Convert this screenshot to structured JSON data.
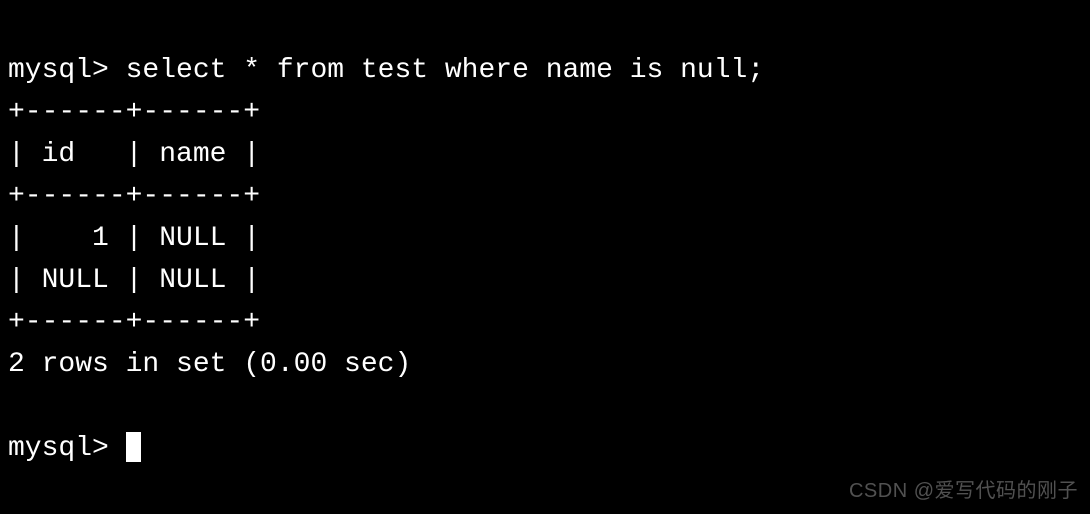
{
  "terminal": {
    "prompt": "mysql> ",
    "query": "select * from test where name is null;",
    "table_border": "+------+------+",
    "header_row": "| id   | name |",
    "data_rows": [
      "|    1 | NULL |",
      "| NULL | NULL |"
    ],
    "status": "2 rows in set (0.00 sec)",
    "empty_line": ""
  },
  "watermark": "CSDN @爱写代码的刚子",
  "chart_data": {
    "type": "table",
    "columns": [
      "id",
      "name"
    ],
    "rows": [
      {
        "id": 1,
        "name": null
      },
      {
        "id": null,
        "name": null
      }
    ],
    "row_count": 2,
    "query_time_sec": 0.0
  }
}
